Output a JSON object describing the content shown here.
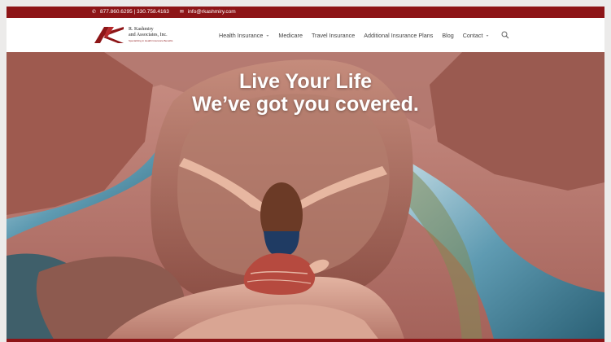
{
  "topbar": {
    "phone": "877.860.6295 | 330.758.4163",
    "email": "info@rkashmiry.com",
    "phone_icon": "phone-icon",
    "email_icon": "envelope-icon"
  },
  "logo": {
    "name_line1": "R. Kashmiry",
    "name_line2": "and Associates, Inc.",
    "tagline": "Specializing in Health Insurance Benefits"
  },
  "nav": {
    "items": [
      {
        "label": "Health Insurance",
        "dropdown": true
      },
      {
        "label": "Medicare",
        "dropdown": false
      },
      {
        "label": "Travel Insurance",
        "dropdown": false
      },
      {
        "label": "Additional Insurance Plans",
        "dropdown": false
      },
      {
        "label": "Blog",
        "dropdown": false
      },
      {
        "label": "Contact",
        "dropdown": true
      }
    ],
    "search_icon": "search-icon",
    "chevron_glyph": "⌄"
  },
  "hero": {
    "headline_line1": "Live Your Life",
    "headline_line2": "We’ve got you covered."
  },
  "colors": {
    "brand": "#8d1517",
    "nav_text": "#444444"
  }
}
